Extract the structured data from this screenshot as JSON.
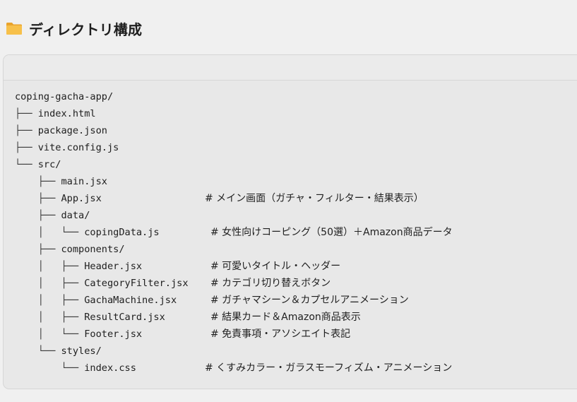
{
  "heading": {
    "icon": "folder-icon",
    "title": "ディレクトリ構成"
  },
  "colors": {
    "background": "#f0f0f0",
    "card": "#e8e8e8",
    "folder_icon": "#f5b33c"
  },
  "tree": [
    {
      "prefix": "",
      "name": "coping-gacha-app/",
      "comment": ""
    },
    {
      "prefix": "├── ",
      "name": "index.html",
      "comment": ""
    },
    {
      "prefix": "├── ",
      "name": "package.json",
      "comment": ""
    },
    {
      "prefix": "├── ",
      "name": "vite.config.js",
      "comment": ""
    },
    {
      "prefix": "└── ",
      "name": "src/",
      "comment": ""
    },
    {
      "prefix": "    ├── ",
      "name": "main.jsx",
      "comment": ""
    },
    {
      "prefix": "    ├── ",
      "name": "App.jsx",
      "comment": "# メイン画面（ガチャ・フィルター・結果表示）"
    },
    {
      "prefix": "    ├── ",
      "name": "data/",
      "comment": ""
    },
    {
      "prefix": "    │   └── ",
      "name": "copingData.js",
      "comment": "# 女性向けコーピング（50選）＋Amazon商品データ"
    },
    {
      "prefix": "    ├── ",
      "name": "components/",
      "comment": ""
    },
    {
      "prefix": "    │   ├── ",
      "name": "Header.jsx",
      "comment": "# 可愛いタイトル・ヘッダー"
    },
    {
      "prefix": "    │   ├── ",
      "name": "CategoryFilter.jsx",
      "comment": "# カテゴリ切り替えボタン"
    },
    {
      "prefix": "    │   ├── ",
      "name": "GachaMachine.jsx",
      "comment": "# ガチャマシーン＆カプセルアニメーション"
    },
    {
      "prefix": "    │   ├── ",
      "name": "ResultCard.jsx",
      "comment": "# 結果カード＆Amazon商品表示"
    },
    {
      "prefix": "    │   └── ",
      "name": "Footer.jsx",
      "comment": "# 免責事項・アソシエイト表記"
    },
    {
      "prefix": "    └── ",
      "name": "styles/",
      "comment": ""
    },
    {
      "prefix": "        └── ",
      "name": "index.css",
      "comment": "# くすみカラー・ガラスモーフィズム・アニメーション"
    }
  ]
}
